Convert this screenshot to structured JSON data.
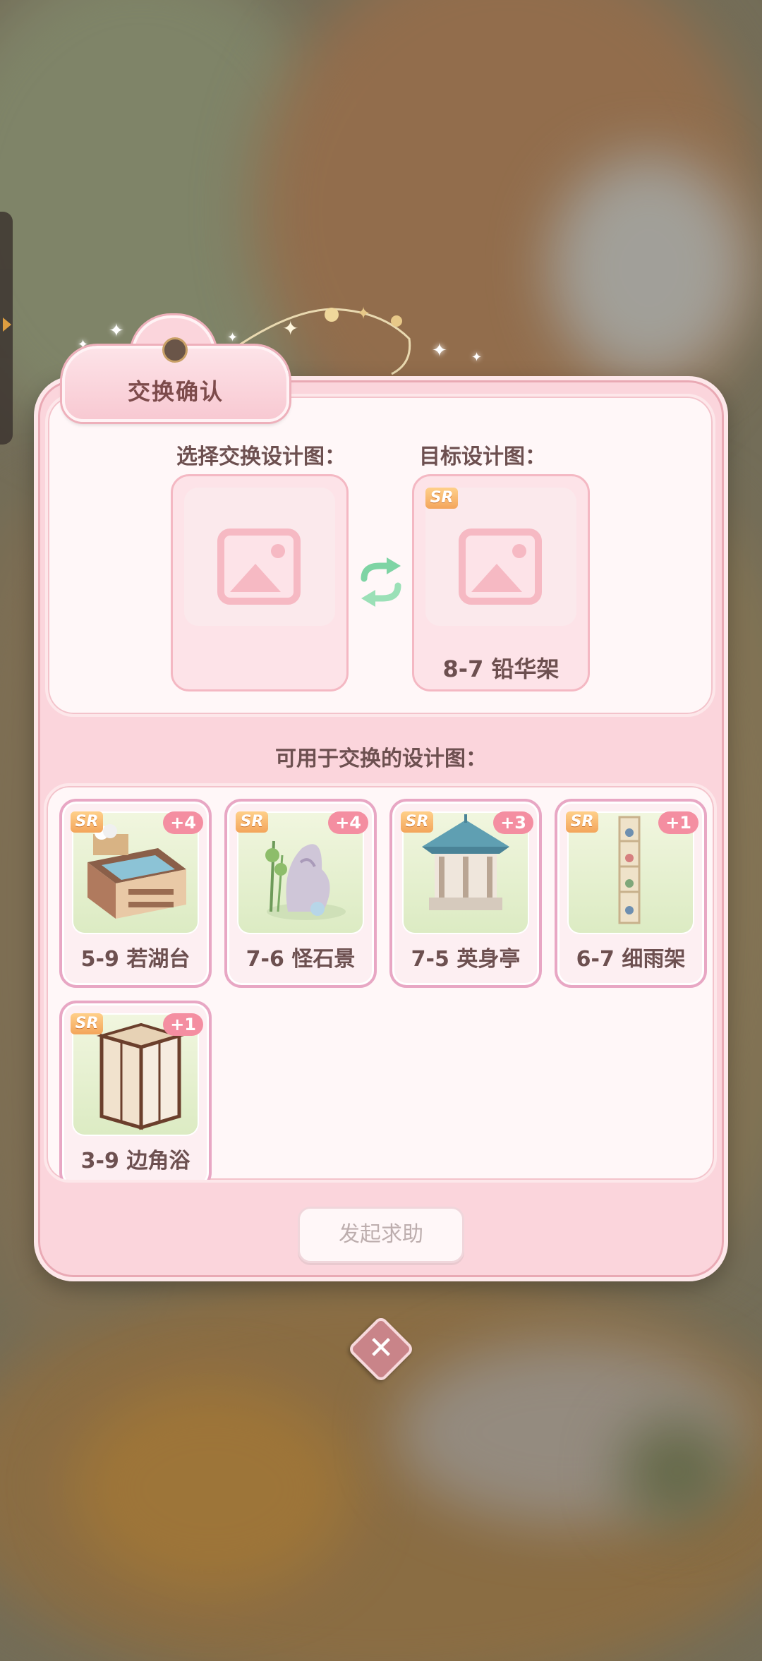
{
  "dialog": {
    "title": "交换确认",
    "select_label": "选择交换设计图：",
    "target_label": "目标设计图：",
    "target_item": {
      "rarity": "SR",
      "name": "8-7 铅华架"
    },
    "available_label": "可用于交换的设计图：",
    "items": [
      {
        "rarity": "SR",
        "count": "+4",
        "name": "5-9 若湖台",
        "icon": "sink-cabinet-icon"
      },
      {
        "rarity": "SR",
        "count": "+4",
        "name": "7-6 怪石景",
        "icon": "rock-garden-icon"
      },
      {
        "rarity": "SR",
        "count": "+3",
        "name": "7-5 英身亭",
        "icon": "pavilion-icon"
      },
      {
        "rarity": "SR",
        "count": "+1",
        "name": "6-7 细雨架",
        "icon": "display-shelf-icon"
      },
      {
        "rarity": "SR",
        "count": "+1",
        "name": "3-9 边角浴",
        "icon": "shower-cabin-icon"
      }
    ],
    "help_button": "发起求助",
    "close_icon": "close-icon"
  },
  "colors": {
    "dialog_bg": "#fbd5dc",
    "panel_bg": "#fff7f8",
    "count_badge": "#f48ea1",
    "rarity_badge": "#f3a55b",
    "text": "#6d5050"
  }
}
